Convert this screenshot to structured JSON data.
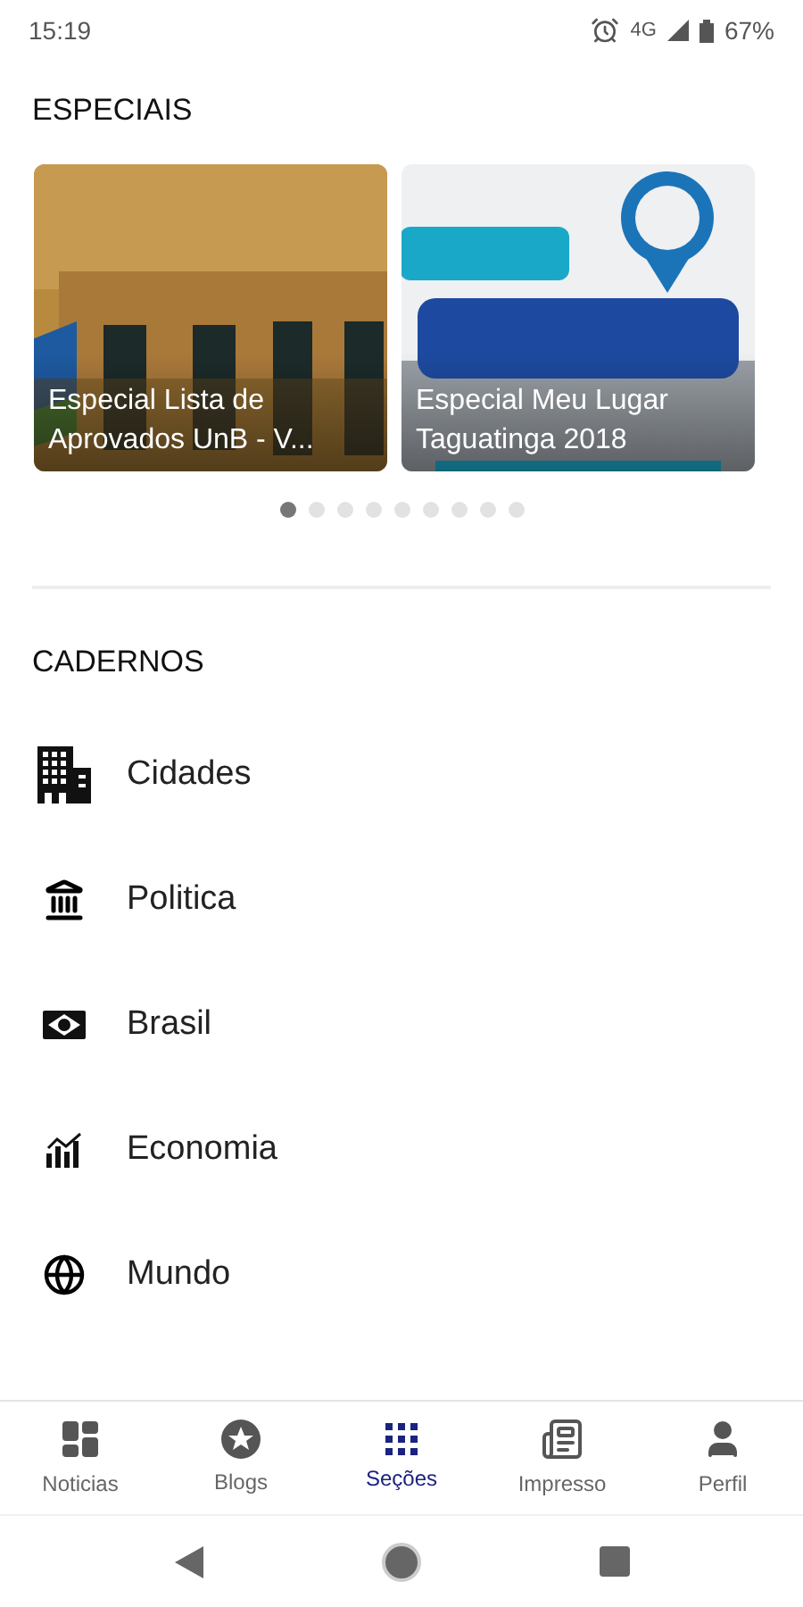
{
  "status_bar": {
    "time": "15:19",
    "network": "4G",
    "battery": "67%"
  },
  "especiais": {
    "title": "ESPECIAIS",
    "cards": [
      {
        "kind": "picture",
        "caption": "Especial Lista de Aprovados UnB - V..."
      },
      {
        "kind": "picture",
        "caption": "Especial Meu Lugar Taguatinga 2018"
      }
    ],
    "dots": [
      {
        "selected": true
      },
      {
        "selected": false
      },
      {
        "selected": false
      },
      {
        "selected": false
      },
      {
        "selected": false
      },
      {
        "selected": false
      },
      {
        "selected": false
      },
      {
        "selected": false
      },
      {
        "selected": false
      }
    ]
  },
  "cadernos": {
    "title": "CADERNOS",
    "items": [
      {
        "kind": "city",
        "label": "Cidades"
      },
      {
        "kind": "politics",
        "label": "Politica"
      },
      {
        "kind": "flag",
        "label": "Brasil"
      },
      {
        "kind": "economy",
        "label": "Economia"
      },
      {
        "kind": "globe",
        "label": "Mundo"
      }
    ]
  },
  "bottom_nav": [
    {
      "kind": "news",
      "label": "Noticias",
      "selected": false
    },
    {
      "kind": "blogs",
      "label": "Blogs",
      "selected": false
    },
    {
      "kind": "sections",
      "label": "Seções",
      "selected": true
    },
    {
      "kind": "print",
      "label": "Impresso",
      "selected": false
    },
    {
      "kind": "profile",
      "label": "Perfil",
      "selected": false
    }
  ]
}
